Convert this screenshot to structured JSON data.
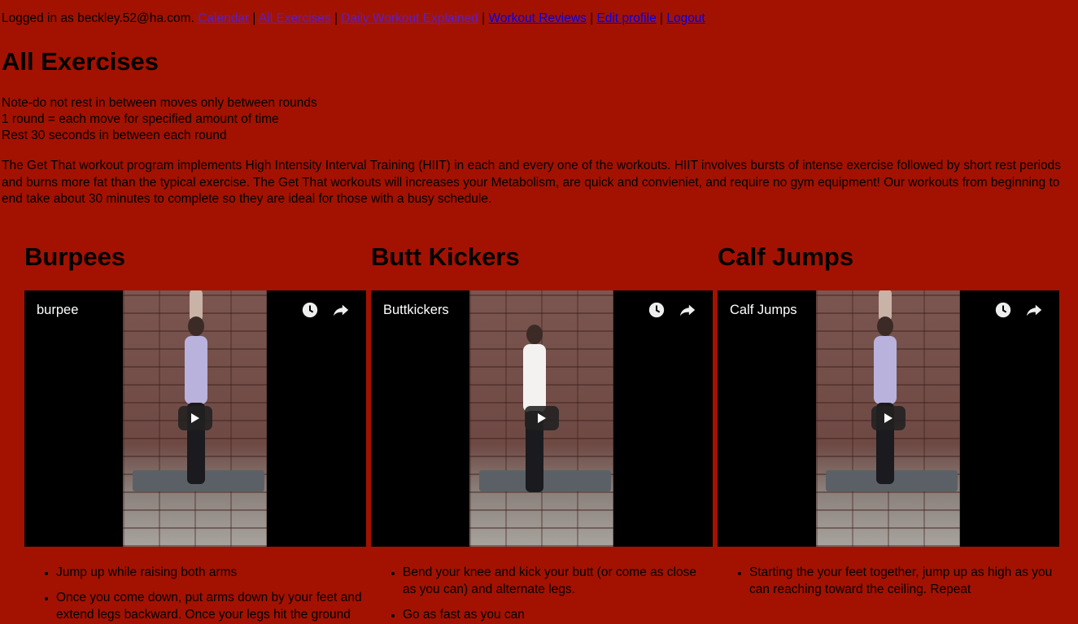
{
  "nav": {
    "logged_in_prefix": "Logged in as ",
    "user_email": "beckley.52@ha.com",
    "period": ".",
    "sep": " | ",
    "links": [
      {
        "label": "Calendar",
        "state": "visited"
      },
      {
        "label": "All Exercises",
        "state": "visited"
      },
      {
        "label": "Daily Workout Explained",
        "state": "visited"
      },
      {
        "label": "Workout Reviews",
        "state": "unvisited"
      },
      {
        "label": "Edit profile",
        "state": "unvisited"
      },
      {
        "label": "Logout",
        "state": "unvisited"
      }
    ]
  },
  "page": {
    "title": "All Exercises",
    "notes": [
      "Note-do not rest in between moves only between rounds",
      "1 round = each move for specified amount of time",
      "Rest 30 seconds in between each round"
    ],
    "description": "The Get That workout program implements High Intensity Interval Training (HIIT) in each and every one of the workouts. HIIT involves bursts of intense exercise followed by short rest periods and burns more fat than the typical exercise. The Get That workouts will increases your Metabolism, are quick and convieniet, and require no gym equipment! Our workouts from beginning to end take about 30 minutes to complete so they are ideal for those with a busy schedule."
  },
  "exercises": [
    {
      "name": "Burpees",
      "video_title": "burpee",
      "steps": [
        "Jump up while raising both arms",
        "Once you come down, put arms down by your feet and extend legs backward. Once your legs hit the ground"
      ]
    },
    {
      "name": "Butt Kickers",
      "video_title": "Buttkickers",
      "steps": [
        "Bend your knee and kick your butt (or come as close as you can) and alternate legs.",
        "Go as fast as you can"
      ]
    },
    {
      "name": "Calf Jumps",
      "video_title": "Calf Jumps",
      "steps": [
        "Starting the your feet together, jump up as high as you can reaching toward the ceiling. Repeat"
      ]
    }
  ],
  "colors": {
    "background": "#a31200",
    "visited_link": "#5a1fcc",
    "unvisited_link": "#0000ee"
  },
  "icons": [
    "watch-later-icon",
    "share-icon",
    "play-icon"
  ]
}
